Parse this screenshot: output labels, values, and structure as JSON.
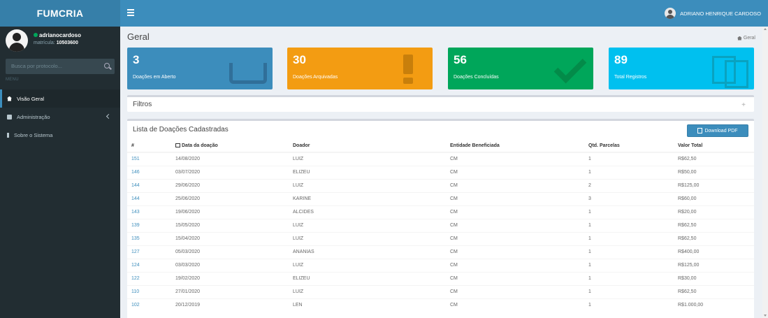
{
  "app": {
    "logo": "FUMCRIA"
  },
  "header": {
    "user_name": "ADRIANO HENRIQUE CARDOSO"
  },
  "sidebar": {
    "user": {
      "name": "adrianocardoso",
      "sub_label": "matrícula:",
      "sub_value": "10503600"
    },
    "search": {
      "placeholder": "Busca por protocolo..."
    },
    "menu_header": "MENU",
    "items": [
      {
        "label": "Visão Geral",
        "icon": "home-icon"
      },
      {
        "label": "Administração",
        "icon": "cog-icon"
      },
      {
        "label": "Sobre o Sistema",
        "icon": "info-icon"
      }
    ]
  },
  "content": {
    "title": "Geral",
    "breadcrumb": "Geral",
    "boxes": [
      {
        "value": "3",
        "label": "Doações em Aberto",
        "color": "#3c8dbc",
        "icon": "inbox-icon"
      },
      {
        "value": "30",
        "label": "Doações Arquivadas",
        "color": "#f39c12",
        "icon": "exclamation-icon"
      },
      {
        "value": "56",
        "label": "Doações Concluídas",
        "color": "#00a65a",
        "icon": "check-icon"
      },
      {
        "value": "89",
        "label": "Total Registros",
        "color": "#00c0ef",
        "icon": "files-icon"
      }
    ],
    "filters": {
      "title": "Filtros",
      "toggle": "+"
    },
    "list": {
      "title": "Lista de Doações Cadastradas",
      "pdf_button": "Download PDF",
      "columns": [
        "#",
        "Data da doação",
        "Doador",
        "Entidade Beneficiada",
        "Qtd. Parcelas",
        "Valor Total"
      ],
      "rows": [
        [
          "151",
          "14/08/2020",
          "LUIZ",
          "CM",
          "1",
          "R$62,50"
        ],
        [
          "146",
          "03/07/2020",
          "ELIZEU",
          "CM",
          "1",
          "R$50,00"
        ],
        [
          "144",
          "29/06/2020",
          "LUIZ",
          "CM",
          "2",
          "R$125,00"
        ],
        [
          "144",
          "25/06/2020",
          "KARINE",
          "CM",
          "3",
          "R$60,00"
        ],
        [
          "143",
          "19/06/2020",
          "ALCIDES",
          "CM",
          "1",
          "R$20,00"
        ],
        [
          "139",
          "15/05/2020",
          "LUIZ",
          "CM",
          "1",
          "R$62,50"
        ],
        [
          "135",
          "15/04/2020",
          "LUIZ",
          "CM",
          "1",
          "R$62,50"
        ],
        [
          "127",
          "05/03/2020",
          "ANANIAS",
          "CM",
          "1",
          "R$400,00"
        ],
        [
          "124",
          "03/03/2020",
          "LUIZ",
          "CM",
          "1",
          "R$125,00"
        ],
        [
          "122",
          "19/02/2020",
          "ELIZEU",
          "CM",
          "1",
          "R$30,00"
        ],
        [
          "110",
          "27/01/2020",
          "LUIZ",
          "CM",
          "1",
          "R$62,50"
        ],
        [
          "102",
          "20/12/2019",
          "LEN",
          "CM",
          "1",
          "R$1.000,00"
        ]
      ]
    }
  }
}
